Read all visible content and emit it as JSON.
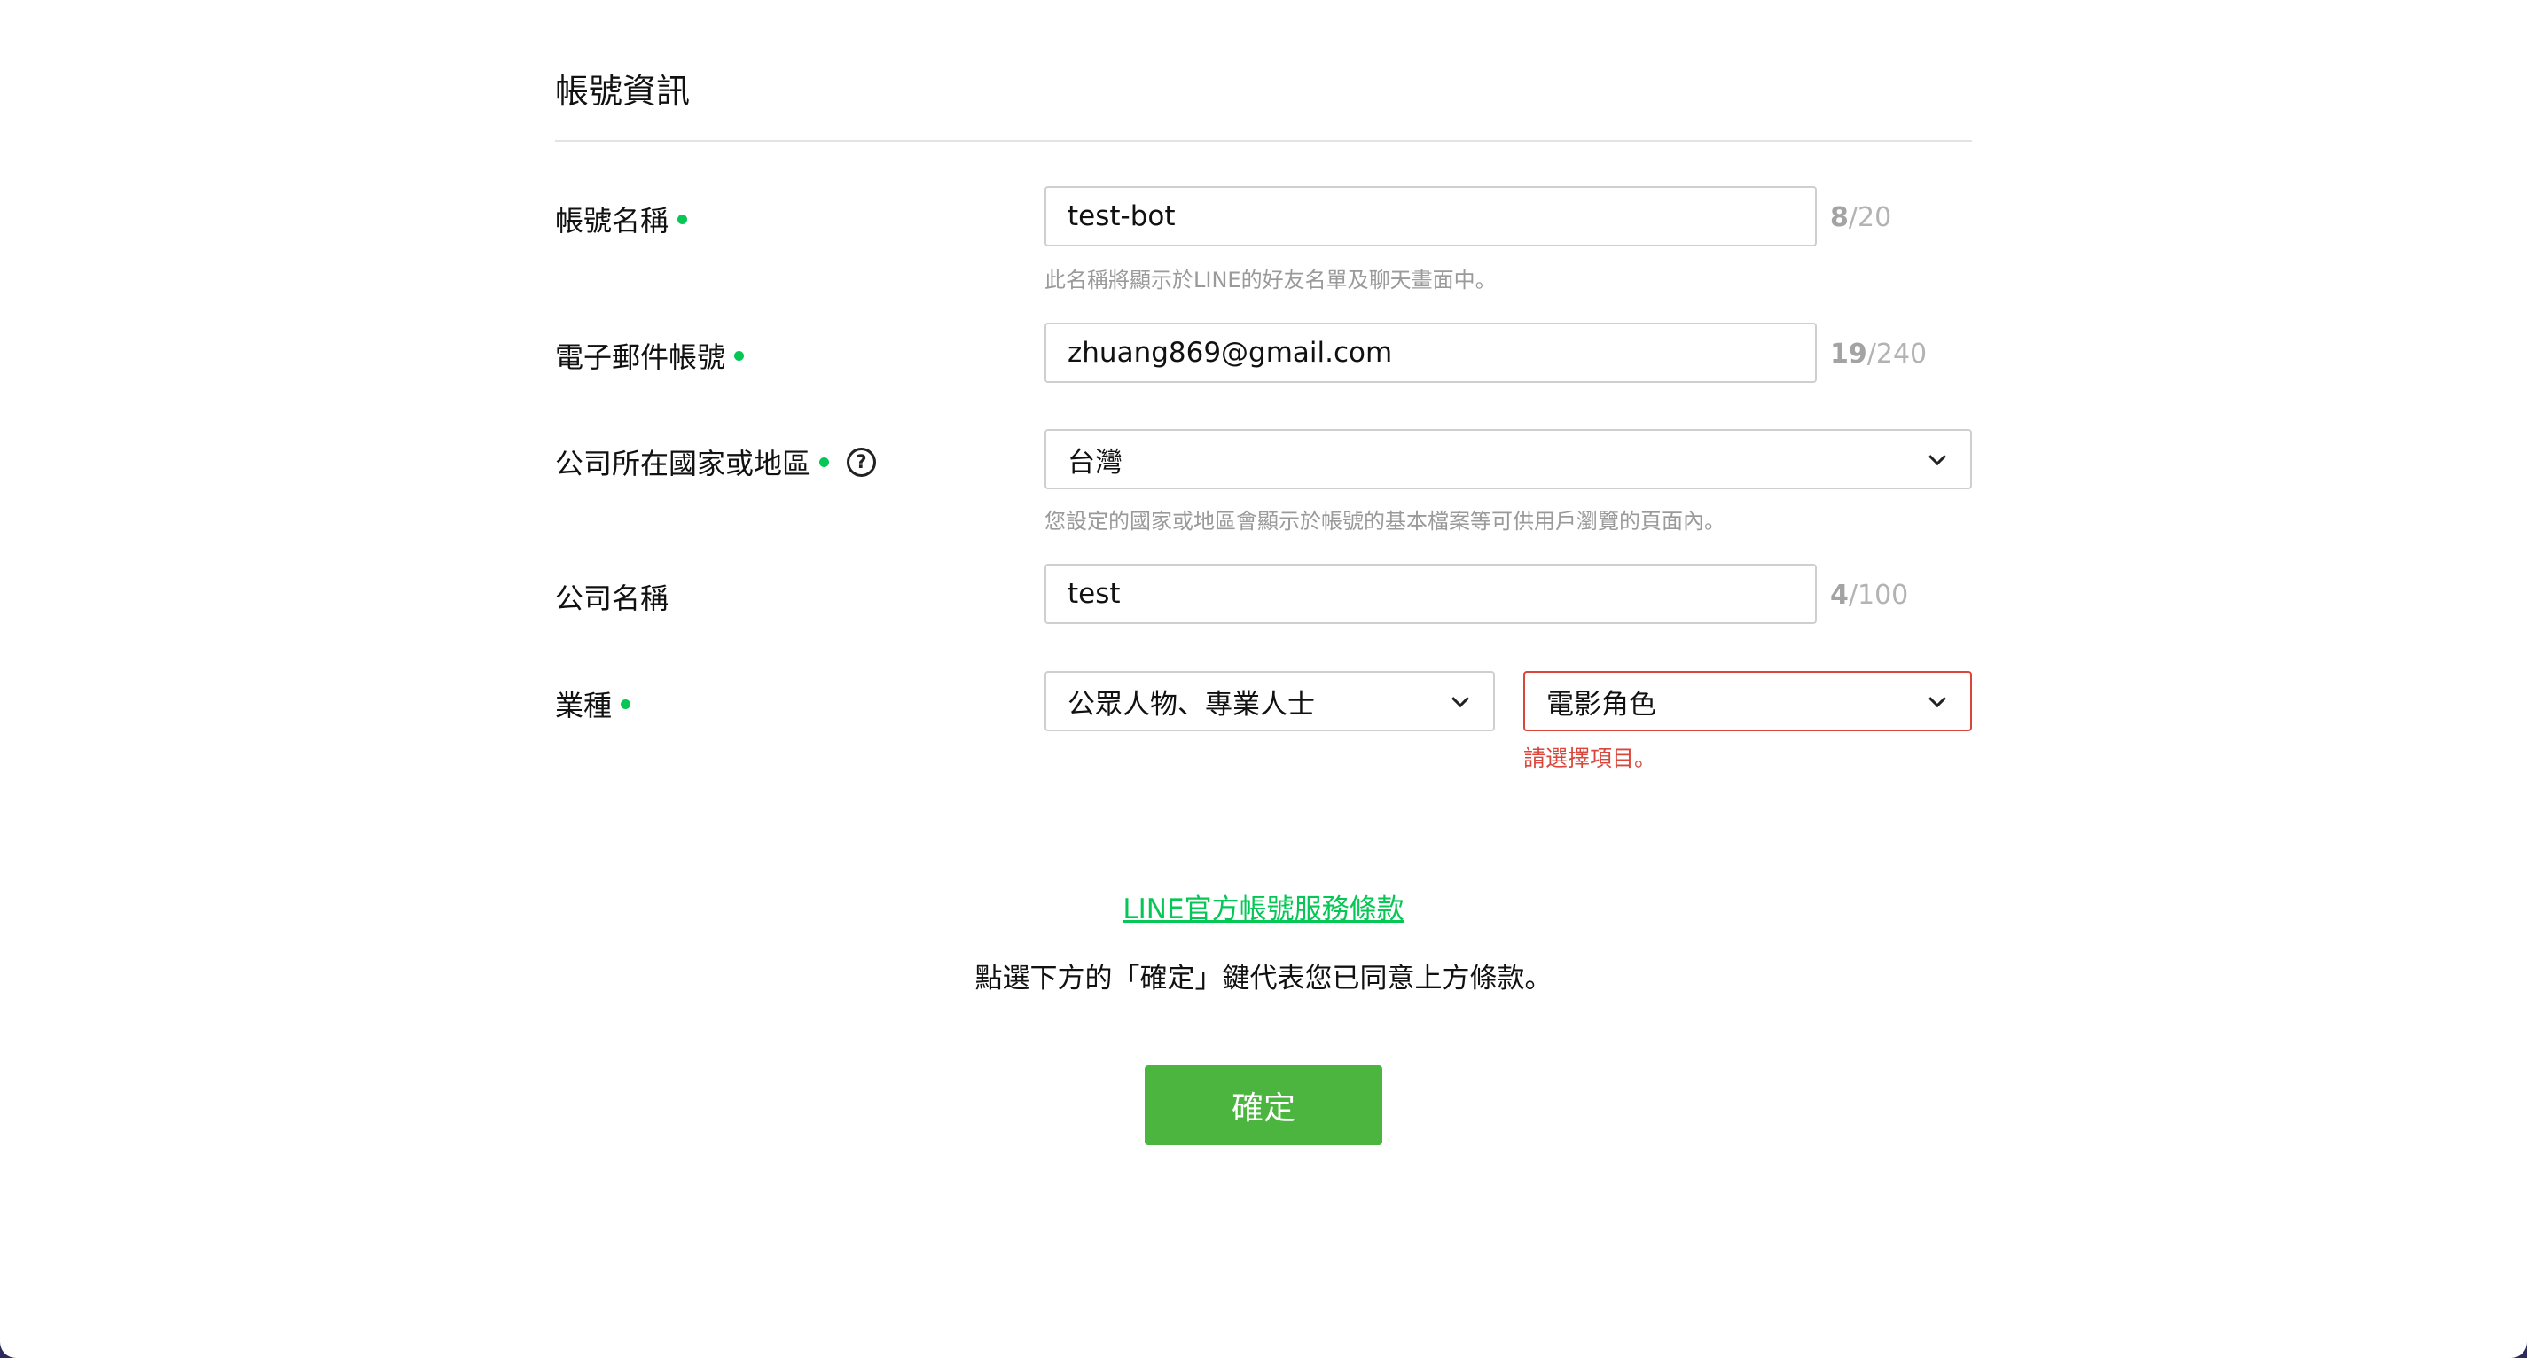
{
  "section": {
    "title": "帳號資訊"
  },
  "fields": {
    "account_name": {
      "label": "帳號名稱",
      "value": "test-bot",
      "count": "8",
      "max": "/20",
      "hint": "此名稱將顯示於LINE的好友名單及聊天畫面中。"
    },
    "email": {
      "label": "電子郵件帳號",
      "value": "zhuang869@gmail.com",
      "count": "19",
      "max": "/240"
    },
    "country": {
      "label": "公司所在國家或地區",
      "value": "台灣",
      "help_icon": "?",
      "hint": "您設定的國家或地區會顯示於帳號的基本檔案等可供用戶瀏覽的頁面內。"
    },
    "company_name": {
      "label": "公司名稱",
      "value": "test",
      "count": "4",
      "max": "/100"
    },
    "industry": {
      "label": "業種",
      "category_value": "公眾人物、專業人士",
      "subcategory_value": "電影角色",
      "error": "請選擇項目。"
    }
  },
  "terms": {
    "link_text": "LINE官方帳號服務條款",
    "note": "點選下方的「確定」鍵代表您已同意上方條款。"
  },
  "confirm_button": {
    "label": "確定"
  },
  "colors": {
    "accent_green": "#06c755",
    "button_green": "#4cb53f",
    "error_red": "#d9473c",
    "frame": "#2b2a5a"
  }
}
